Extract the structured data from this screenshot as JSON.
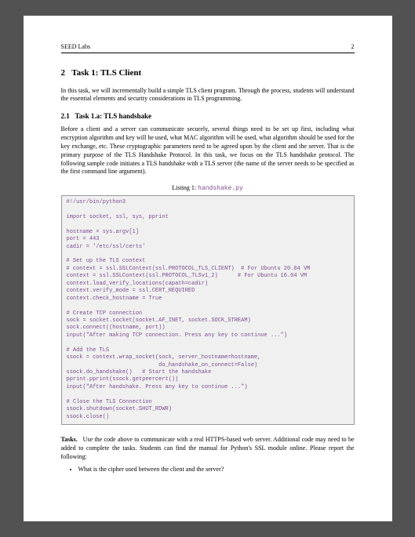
{
  "header": {
    "title": "SEED Labs",
    "page_number": "2"
  },
  "section": {
    "number": "2",
    "title": "Task 1: TLS Client"
  },
  "intro_para": "In this task, we will incrementally build a simple TLS client program. Through the process, students will understand the essential elements and security considerations in TLS programming.",
  "subsection": {
    "number": "2.1",
    "title": "Task 1.a: TLS handshake"
  },
  "handshake_para": "Before a client and a server can communicate securely, several things need to be set up first, including what encryption algorithm and key will be used, what MAC algorithm will be used, what algorithm should be used for the key exchange, etc. These cryptographic parameters need to be agreed upon by the client and the server. That is the primary purpose of the TLS Handshake Protocol. In this task, we focus on the TLS handshake protocol. The following sample code initiates a TLS handshake with a TLS server (the name of the server needs to be specified as the first command line argument).",
  "listing": {
    "label": "Listing 1:",
    "filename": "handshake.py",
    "code": "#!/usr/bin/python3\n\nimport socket, ssl, sys, pprint\n\nhostname = sys.argv[1]\nport = 443\ncadir = '/etc/ssl/certs'\n\n# Set up the TLS context\n# context = ssl.SSLContext(ssl.PROTOCOL_TLS_CLIENT)  # For Ubuntu 20.04 VM\ncontext = ssl.SSLContext(ssl.PROTOCOL_TLSv1_2)      # For Ubuntu 16.04 VM\ncontext.load_verify_locations(capath=cadir)\ncontext.verify_mode = ssl.CERT_REQUIRED\ncontext.check_hostname = True\n\n# Create TCP connection\nsock = socket.socket(socket.AF_INET, socket.SOCK_STREAM)\nsock.connect((hostname, port))\ninput(\"After making TCP connection. Press any key to continue ...\")\n\n# Add the TLS\nssock = context.wrap_socket(sock, server_hostname=hostname,\n                            do_handshake_on_connect=False)\nssock.do_handshake()   # Start the handshake\npprint.pprint(ssock.getpeercert())\ninput(\"After handshake. Press any key to continue ...\")\n\n# Close the TLS Connection\nssock.shutdown(socket.SHUT_RDWR)\nssock.close()"
  },
  "tasks": {
    "label": "Tasks.",
    "text": "Use the code above to communicate with a real HTTPS-based web server. Additional code may need to be added to complete the tasks. Students can find the manual for Python's SSL module online. Please report the following:"
  },
  "bullets": [
    "What is the cipher used between the client and the server?"
  ]
}
